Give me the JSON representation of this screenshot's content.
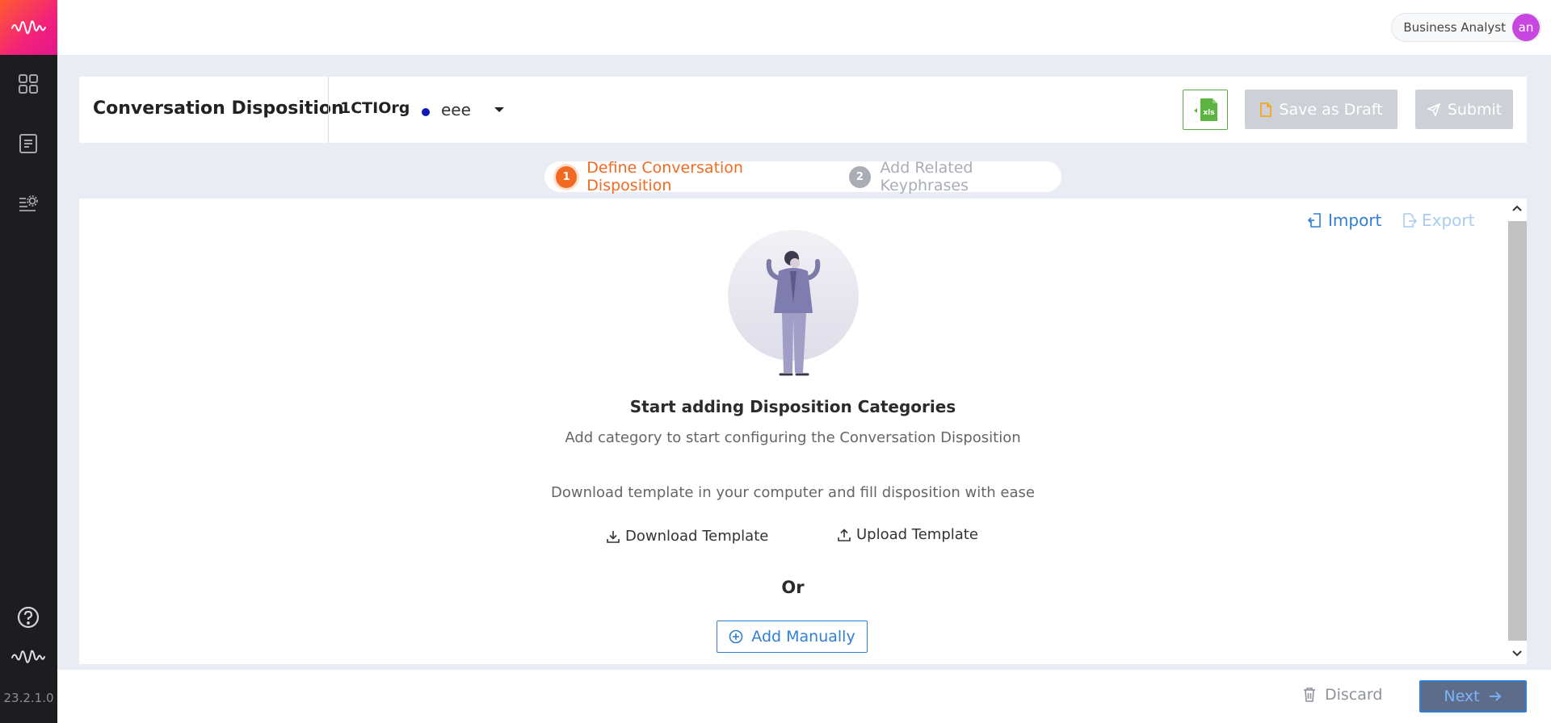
{
  "app": {
    "version": "23.2.1.0",
    "icons": {
      "logo": "waveform-logo-icon",
      "dashboard": "grid-icon",
      "reports": "document-list-icon",
      "settings": "list-settings-icon",
      "help": "help-circle-icon",
      "brand": "waveform-icon"
    }
  },
  "topbar": {
    "role": "Business Analyst",
    "avatar_initials": "an"
  },
  "header": {
    "title": "Conversation Disposition",
    "org": "1CTIOrg",
    "environment": "eee",
    "status_color": "#0d1ab3",
    "xls_label": "xls",
    "save_draft_label": "Save as Draft",
    "submit_label": "Submit"
  },
  "stepper": {
    "steps": [
      {
        "number": "1",
        "label": "Define Conversation Disposition",
        "state": "active"
      },
      {
        "number": "2",
        "label": "Add Related Keyphrases",
        "state": "inactive"
      }
    ],
    "active_color": "#f26a21",
    "inactive_color": "#a9adb5"
  },
  "content": {
    "import_label": "Import",
    "export_label": "Export",
    "empty_title": "Start adding Disposition Categories",
    "empty_subtitle": "Add category to start configuring the Conversation Disposition",
    "download_hint": "Download template in your computer and fill disposition with ease",
    "download_template_label": "Download Template",
    "upload_template_label": "Upload Template",
    "or_label": "Or",
    "add_manually_label": "Add Manually"
  },
  "footer": {
    "discard_label": "Discard",
    "next_label": "Next"
  }
}
